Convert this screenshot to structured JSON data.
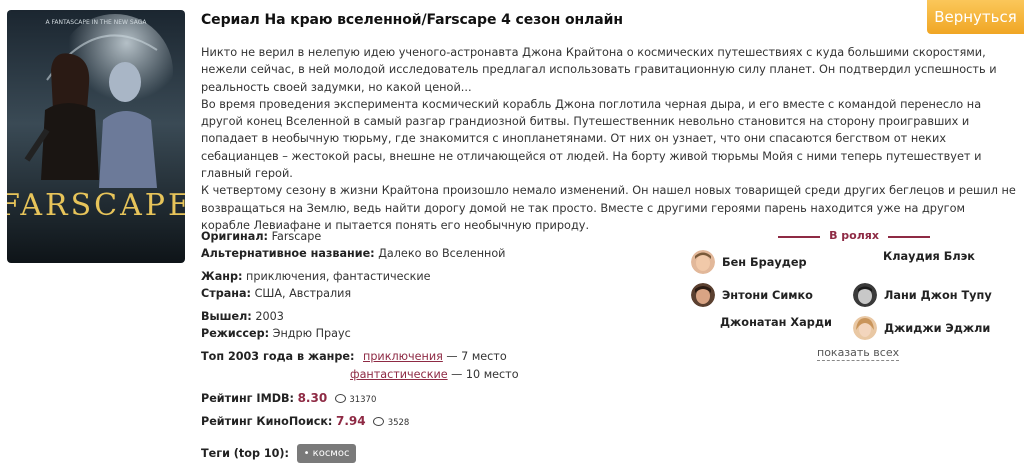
{
  "title": "Сериал На краю вселенной/Farscape 4 сезон онлайн",
  "back_button": "Вернуться",
  "poster": {
    "tagline": "A FANTASCAPE IN THE NEW SAGA",
    "logo": "FARSCAPE"
  },
  "description": [
    "Никто не верил в нелепую идею ученого-астронавта Джона Крайтона о космических путешествиях с куда большими скоростями, нежели сейчас, в ней молодой исследователь предлагал использовать гравитационную силу планет. Он подтвердил успешность и реальность своей задумки, но какой ценой...",
    "Во время проведения эксперимента космический корабль Джона поглотила черная дыра, и его вместе с командой перенесло на другой конец Вселенной в самый разгар грандиозной битвы. Путешественник невольно становится на сторону проигравших и попадает в необычную тюрьму, где знакомится с инопланетянами. От них он узнает, что они спасаются бегством от неких себацианцев – жестокой расы, внешне не отличающейся от людей. На борту живой тюрьмы Мойя с ними теперь путешествует и главный герой.",
    "К четвертому сезону в жизни Крайтона произошло немало изменений. Он нашел новых товарищей среди других беглецов и решил не возвращаться на Землю, ведь найти дорогу домой не так просто. Вместе с другими героями парень находится уже на другом корабле Левиафане и пытается понять его необычную природу."
  ],
  "info": {
    "original_label": "Оригинал:",
    "original": "Farscape",
    "alt_label": "Альтернативное название:",
    "alt": "Далеко во Вселенной",
    "genre_label": "Жанр:",
    "genre": "приключения, фантастические",
    "country_label": "Страна:",
    "country": "США, Австралия",
    "year_label": "Вышел:",
    "year": "2003",
    "director_label": "Режиссер:",
    "director": "Эндрю Праус",
    "top_label": "Топ 2003 года в жанре:",
    "top": [
      {
        "genre": "приключения",
        "place": "— 7 место"
      },
      {
        "genre": "фантастические",
        "place": "— 10 место"
      }
    ],
    "imdb_label": "Рейтинг IMDB:",
    "imdb": "8.30",
    "imdb_votes": "31370",
    "kp_label": "Рейтинг КиноПоиск:",
    "kp": "7.94",
    "kp_votes": "3528",
    "tags_label": "Теги (top 10):",
    "tag": "• космос"
  },
  "cast": {
    "heading": "В ролях",
    "actors": [
      {
        "name": "Бен Браудер"
      },
      {
        "name": "Клаудия Блэк"
      },
      {
        "name": "Энтони Симко"
      },
      {
        "name": "Лани Джон Тупу"
      },
      {
        "name": "Джонатан Харди"
      },
      {
        "name": "Джиджи Эджли"
      }
    ],
    "show_all": "показать всех"
  }
}
